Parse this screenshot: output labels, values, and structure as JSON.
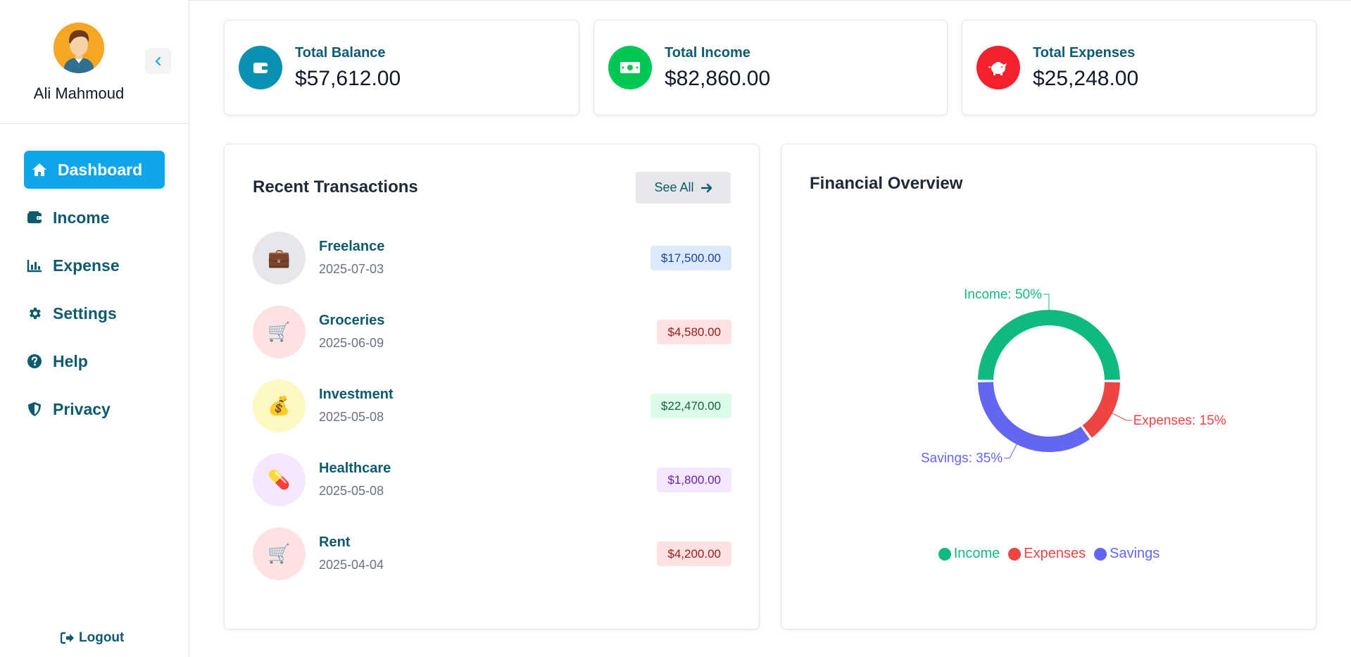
{
  "sidebar": {
    "user_name": "Ali Mahmoud",
    "nav": [
      {
        "label": "Dashboard",
        "icon": "home-icon"
      },
      {
        "label": "Income",
        "icon": "wallet-icon"
      },
      {
        "label": "Expense",
        "icon": "chart-icon"
      },
      {
        "label": "Settings",
        "icon": "gear-icon"
      },
      {
        "label": "Help",
        "icon": "question-icon"
      },
      {
        "label": "Privacy",
        "icon": "shield-icon"
      }
    ],
    "active_item": "Dashboard",
    "logout_label": "Logout"
  },
  "stats": [
    {
      "label": "Total Balance",
      "value": "$57,612.00",
      "icon": "wallet-icon",
      "color": "#0891b2"
    },
    {
      "label": "Total Income",
      "value": "$82,860.00",
      "icon": "money-icon",
      "color": "#00c853"
    },
    {
      "label": "Total Expenses",
      "value": "$25,248.00",
      "icon": "piggy-bank-icon",
      "color": "#f5222d"
    }
  ],
  "transactions": {
    "title": "Recent Transactions",
    "see_all_label": "See All",
    "items": [
      {
        "name": "Freelance",
        "date": "2025-07-03",
        "amount": "$17,500.00",
        "icon": "💼",
        "icon_bg": "#e5e7eb",
        "badge_bg": "#dbeafe",
        "badge_color": "#1e40af"
      },
      {
        "name": "Groceries",
        "date": "2025-06-09",
        "amount": "$4,580.00",
        "icon": "🛒",
        "icon_bg": "#fee2e2",
        "badge_bg": "#fee2e2",
        "badge_color": "#991b1b"
      },
      {
        "name": "Investment",
        "date": "2025-05-08",
        "amount": "$22,470.00",
        "icon": "💰",
        "icon_bg": "#fef9c3",
        "badge_bg": "#dcfce7",
        "badge_color": "#166534"
      },
      {
        "name": "Healthcare",
        "date": "2025-05-08",
        "amount": "$1,800.00",
        "icon": "💊",
        "icon_bg": "#f3e8ff",
        "badge_bg": "#f3e8ff",
        "badge_color": "#6b21a8"
      },
      {
        "name": "Rent",
        "date": "2025-04-04",
        "amount": "$4,200.00",
        "icon": "🛒",
        "icon_bg": "#fee2e2",
        "badge_bg": "#fee2e2",
        "badge_color": "#991b1b"
      }
    ]
  },
  "overview": {
    "title": "Financial Overview",
    "chart_data": {
      "type": "pie",
      "categories": [
        "Income",
        "Expenses",
        "Savings"
      ],
      "values": [
        50,
        15,
        35
      ],
      "labels": [
        "Income: 50%",
        "Expenses: 15%",
        "Savings: 35%"
      ],
      "colors": [
        "#10b981",
        "#ef4444",
        "#6366f1"
      ],
      "legend_position": "bottom"
    }
  }
}
